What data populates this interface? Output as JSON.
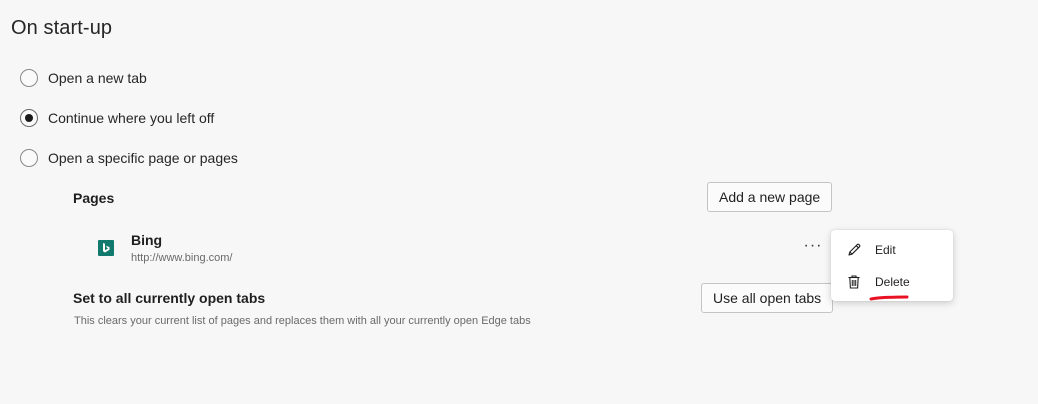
{
  "section": {
    "title": "On start-up"
  },
  "startup_options": [
    {
      "label": "Open a new tab",
      "selected": false
    },
    {
      "label": "Continue where you left off",
      "selected": true
    },
    {
      "label": "Open a specific page or pages",
      "selected": false
    }
  ],
  "pages": {
    "heading": "Pages",
    "add_button_label": "Add a new page",
    "items": [
      {
        "name": "Bing",
        "url": "http://www.bing.com/",
        "icon": "bing-favicon-icon",
        "more_label": "···"
      }
    ]
  },
  "set_all": {
    "title": "Set to all currently open tabs",
    "description": "This clears your current list of pages and replaces them with all your currently open Edge tabs",
    "button_label": "Use all open tabs"
  },
  "context_menu": {
    "items": [
      {
        "label": "Edit",
        "icon": "pencil-icon"
      },
      {
        "label": "Delete",
        "icon": "trash-icon"
      }
    ],
    "highlight_color": "#e81123"
  },
  "colors": {
    "background": "#f7f7f7",
    "favicon_bg": "#11796d",
    "annotation_red": "#e81123"
  }
}
